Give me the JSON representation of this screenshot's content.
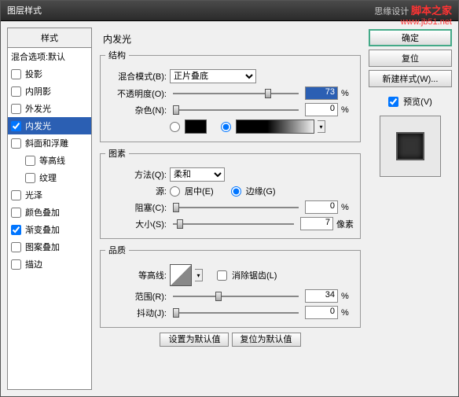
{
  "title": "图层样式",
  "watermark": {
    "cn": "思缘设计",
    "brand": "脚本之家",
    "url": "www.jb51.net"
  },
  "sidebar": {
    "header": "样式",
    "items": [
      {
        "label": "混合选项:默认",
        "checked": null
      },
      {
        "label": "投影",
        "checked": false
      },
      {
        "label": "内阴影",
        "checked": false
      },
      {
        "label": "外发光",
        "checked": false
      },
      {
        "label": "内发光",
        "checked": true,
        "selected": true
      },
      {
        "label": "斜面和浮雕",
        "checked": false
      },
      {
        "label": "等高线",
        "checked": false,
        "indent": true
      },
      {
        "label": "纹理",
        "checked": false,
        "indent": true
      },
      {
        "label": "光泽",
        "checked": false
      },
      {
        "label": "颜色叠加",
        "checked": false
      },
      {
        "label": "渐变叠加",
        "checked": true
      },
      {
        "label": "图案叠加",
        "checked": false
      },
      {
        "label": "描边",
        "checked": false
      }
    ]
  },
  "panel": {
    "title": "内发光",
    "structure": {
      "legend": "结构",
      "blend": {
        "label": "混合模式(B):",
        "value": "正片叠底"
      },
      "opacity": {
        "label": "不透明度(O):",
        "value": "73",
        "unit": "%",
        "pos": 73
      },
      "noise": {
        "label": "杂色(N):",
        "value": "0",
        "unit": "%",
        "pos": 0
      }
    },
    "elements": {
      "legend": "图素",
      "technique": {
        "label": "方法(Q):",
        "value": "柔和"
      },
      "source": {
        "label": "源:",
        "center": "居中(E)",
        "edge": "边缘(G)"
      },
      "choke": {
        "label": "阻塞(C):",
        "value": "0",
        "unit": "%",
        "pos": 0
      },
      "ssize": {
        "label": "大小(S):",
        "value": "7",
        "unit": "像素",
        "pos": 3
      }
    },
    "quality": {
      "legend": "品质",
      "contour": {
        "label": "等高线:",
        "aa": "消除锯齿(L)"
      },
      "range": {
        "label": "范围(R):",
        "value": "34",
        "unit": "%",
        "pos": 34
      },
      "jitter": {
        "label": "抖动(J):",
        "value": "0",
        "unit": "%",
        "pos": 0
      }
    },
    "btns": {
      "default": "设置为默认值",
      "reset": "复位为默认值"
    }
  },
  "right": {
    "ok": "确定",
    "cancel": "复位",
    "newstyle": "新建样式(W)...",
    "preview": "预览(V)"
  }
}
